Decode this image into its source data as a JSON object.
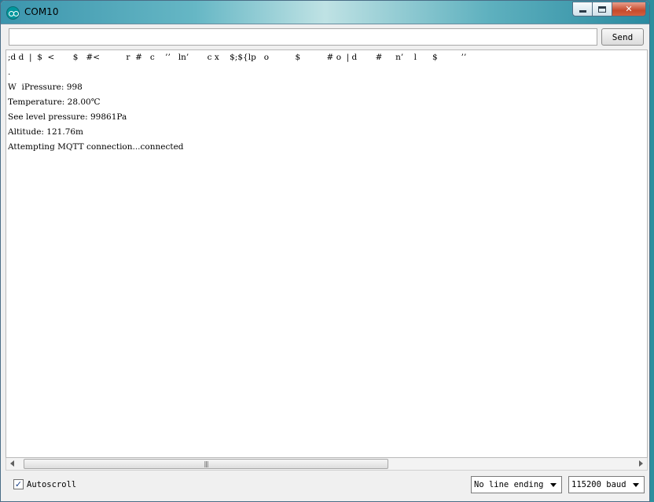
{
  "window": {
    "title": "COM10",
    "icon": "arduino-logo-icon",
    "controls": {
      "minimize": "minimize-icon",
      "maximize": "maximize-icon",
      "close": "✕"
    }
  },
  "send_bar": {
    "input_value": "",
    "input_placeholder": "",
    "send_label": "Send"
  },
  "output": {
    "lines": [
      ";d d  |  $  <       $   #<          r  #   c    ’’   ln’       c x    $;${lp   o          $          # o  | d       #     n’    l      $         ’’",
      ".",
      "W  iPressure: 998",
      "Temperature: 28.00℃",
      "See level pressure: 99861Pa",
      "Altitude: 121.76m",
      "Attempting MQTT connection...connected"
    ]
  },
  "scrollbar": {
    "grip": "|||",
    "thumb_fraction": 0.6
  },
  "footer": {
    "autoscroll_label": "Autoscroll",
    "autoscroll_checked": "✓",
    "line_ending": "No line ending",
    "baud_rate": "115200 baud"
  }
}
